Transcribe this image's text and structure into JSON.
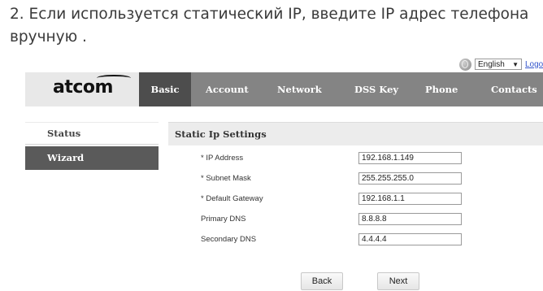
{
  "caption": {
    "line1": "2. Если используется статический IP, введите IP адрес телефона",
    "line2": "вручную ."
  },
  "topbar": {
    "language": "English",
    "logout_label": "Logout"
  },
  "logo": {
    "text": "atcom"
  },
  "nav": {
    "tabs": [
      {
        "label": "Basic",
        "active": true
      },
      {
        "label": "Account",
        "active": false
      },
      {
        "label": "Network",
        "active": false
      },
      {
        "label": "DSS Key",
        "active": false
      },
      {
        "label": "Phone",
        "active": false
      },
      {
        "label": "Contacts",
        "active": false
      }
    ]
  },
  "sidebar": {
    "items": [
      {
        "label": "Status",
        "active": false
      },
      {
        "label": "Wizard",
        "active": true
      }
    ]
  },
  "main": {
    "section_title": "Static Ip Settings",
    "fields": [
      {
        "label": "* IP Address",
        "value": "192.168.1.149"
      },
      {
        "label": "* Subnet Mask",
        "value": "255.255.255.0"
      },
      {
        "label": "* Default Gateway",
        "value": "192.168.1.1"
      },
      {
        "label": "Primary DNS",
        "value": "8.8.8.8"
      },
      {
        "label": "Secondary DNS",
        "value": "4.4.4.4"
      }
    ],
    "back_label": "Back",
    "next_label": "Next"
  },
  "colors": {
    "navbar": "#848484",
    "nav_active": "#4d4d4d",
    "sidebar_active": "#5a5a5a",
    "section_header": "#ececec"
  }
}
